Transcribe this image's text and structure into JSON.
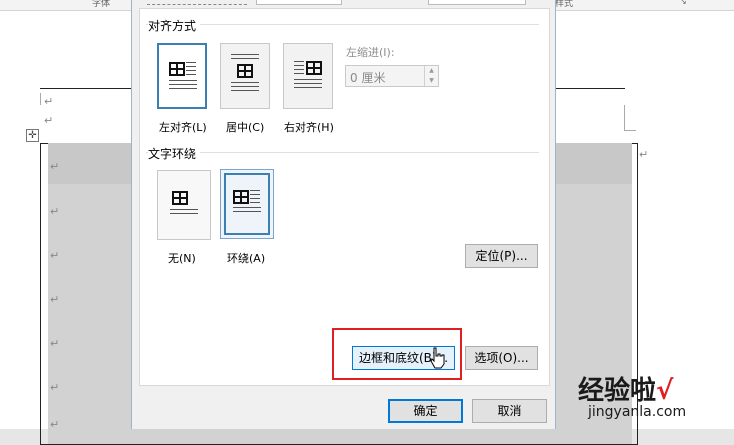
{
  "ribbon": {
    "font_group": "字体",
    "style_group": "样式"
  },
  "dialog": {
    "alignment": {
      "title": "对齐方式",
      "left_label": "左对齐(L)",
      "center_label": "居中(C)",
      "right_label": "右对齐(H)",
      "indent_label": "左缩进(I):",
      "indent_value": "0 厘米"
    },
    "wrapping": {
      "title": "文字环绕",
      "none_label": "无(N)",
      "around_label": "环绕(A)",
      "position_button": "定位(P)..."
    },
    "borders_button": "边框和底纹(B)...",
    "options_button": "选项(O)...",
    "ok_button": "确定",
    "cancel_button": "取消"
  },
  "document": {
    "paragraph_mark": "↵",
    "move_handle": "✛"
  },
  "watermark": {
    "brand": "经验啦",
    "check": "√",
    "site": "jingyanla.com"
  },
  "colors": {
    "selection_blue": "#3c7fb1",
    "highlight_red": "#e02020"
  }
}
